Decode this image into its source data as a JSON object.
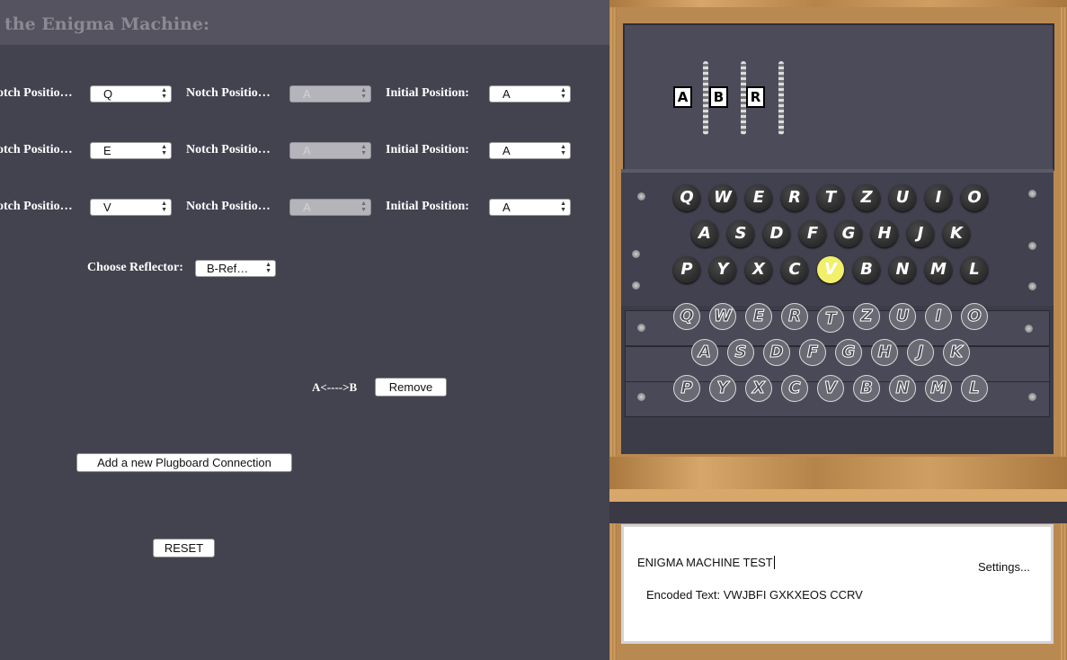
{
  "title": "the Enigma Machine:",
  "rotor_rows": [
    {
      "notch_label": "otch Positio…",
      "notch_value": "Q",
      "notch2_label": "Notch Positio…",
      "notch2_value": "A",
      "initial_label": "Initial Position:",
      "initial_value": "A"
    },
    {
      "notch_label": "otch Positio…",
      "notch_value": "E",
      "notch2_label": "Notch Positio…",
      "notch2_value": "A",
      "initial_label": "Initial Position:",
      "initial_value": "A"
    },
    {
      "notch_label": "otch Positio…",
      "notch_value": "V",
      "notch2_label": "Notch Positio…",
      "notch2_value": "A",
      "initial_label": "Initial Position:",
      "initial_value": "A"
    }
  ],
  "reflector": {
    "label": "Choose Reflector:",
    "value": "B-Ref…"
  },
  "plugboard": {
    "connection": "A<---->B",
    "remove_label": "Remove",
    "add_label": "Add a new Plugboard Connection"
  },
  "reset_label": "RESET",
  "rotor_windows": [
    "A",
    "B",
    "R"
  ],
  "keyboard_rows": [
    [
      "Q",
      "W",
      "E",
      "R",
      "T",
      "Z",
      "U",
      "I",
      "O"
    ],
    [
      "A",
      "S",
      "D",
      "F",
      "G",
      "H",
      "J",
      "K"
    ],
    [
      "P",
      "Y",
      "X",
      "C",
      "V",
      "B",
      "N",
      "M",
      "L"
    ]
  ],
  "lit_lamp": "V",
  "pressed_key": "T",
  "input_text": "ENIGMA MACHINE TEST",
  "encoded_label": "Encoded Text: VWJBFI GXKXEOS CCRV",
  "settings_label": "Settings...",
  "colors": {
    "panel": "#434350",
    "lamp_lit": "#f2ef6a",
    "wood": "#b98952"
  }
}
